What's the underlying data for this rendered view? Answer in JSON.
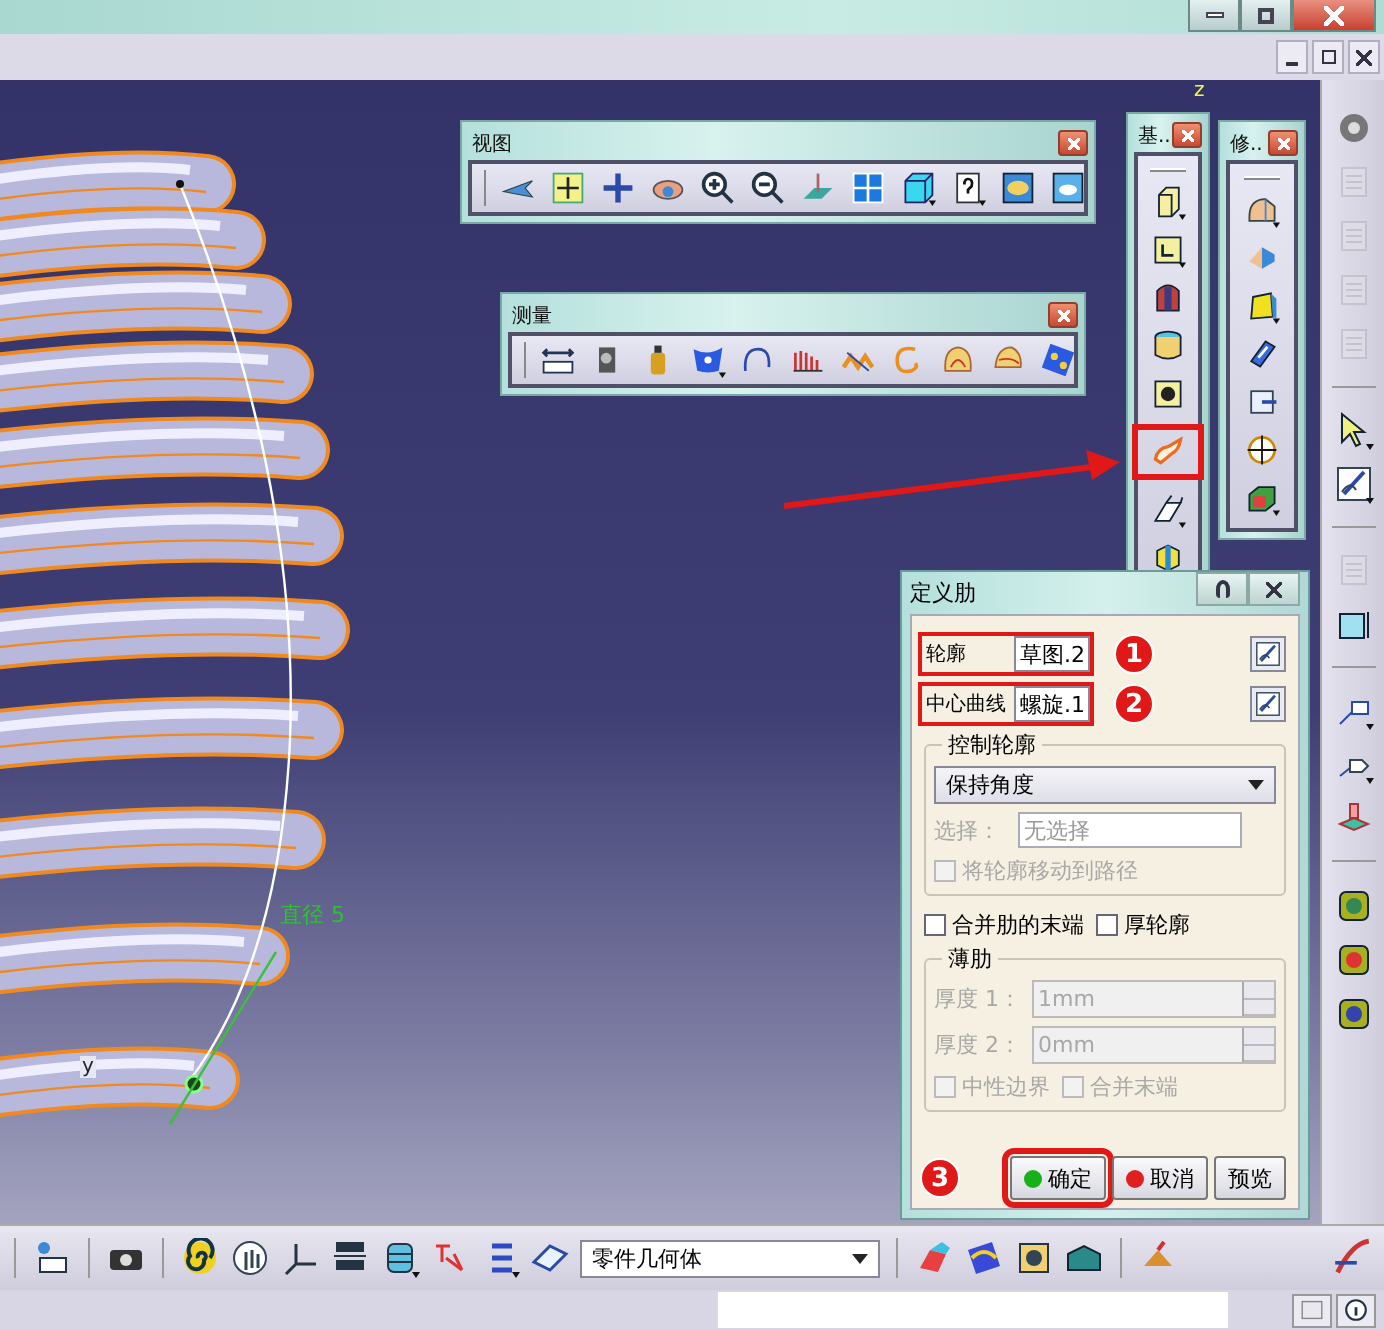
{
  "viewport": {
    "dimension_label": "直径 5",
    "axis_labels": [
      {
        "text": "z",
        "kind": "compass"
      },
      {
        "text": "y",
        "kind": "axis"
      }
    ]
  },
  "toolbars": [
    {
      "title": "视图",
      "kind": "view"
    },
    {
      "title": "测量",
      "kind": "measure"
    },
    {
      "title": "基..",
      "kind": "sketch_based"
    },
    {
      "title": "修..",
      "kind": "dress_up"
    }
  ],
  "dialog": {
    "title": "定义肋",
    "fields": [
      {
        "label": "轮廓",
        "value": "草图.2",
        "marker": "1"
      },
      {
        "label": "中心曲线",
        "value": "螺旋.1",
        "marker": "2"
      }
    ],
    "profile_control": {
      "title": "控制轮廓",
      "dropdown": "保持角度",
      "selection_label": "选择：",
      "selection_placeholder": "无选择",
      "move_option": {
        "label": "将轮廓移动到路径",
        "checked": false,
        "disabled": true
      }
    },
    "options": [
      {
        "label": "合并肋的末端",
        "checked": false,
        "disabled": false
      },
      {
        "label": "厚轮廓",
        "checked": false,
        "disabled": false
      }
    ],
    "thin_rib": {
      "title": "薄肋",
      "thicknesses": [
        {
          "label": "厚度 1：",
          "value": "1mm",
          "disabled": true
        },
        {
          "label": "厚度 2：",
          "value": "0mm",
          "disabled": true
        }
      ],
      "options": [
        {
          "label": "中性边界",
          "checked": false,
          "disabled": true
        },
        {
          "label": "合并末端",
          "checked": false,
          "disabled": true
        }
      ]
    },
    "buttons": [
      {
        "label": "确定",
        "kind": "ok",
        "marker": "3"
      },
      {
        "label": "取消",
        "kind": "cancel"
      },
      {
        "label": "预览",
        "kind": "preview"
      }
    ]
  },
  "bottom_toolbar": {
    "body_dropdown": "零件几何体"
  }
}
